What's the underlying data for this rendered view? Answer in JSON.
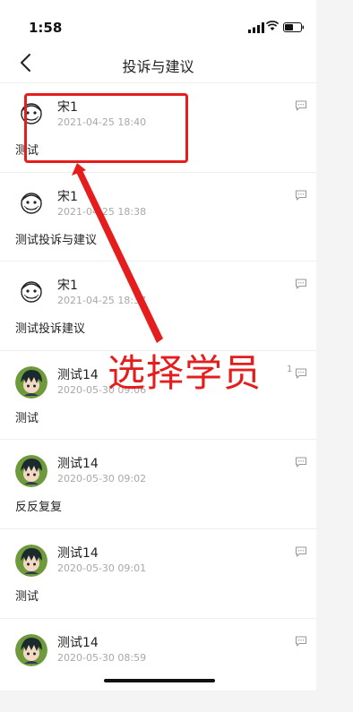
{
  "status_bar": {
    "time": "1:58"
  },
  "header": {
    "title": "投诉与建议"
  },
  "items": [
    {
      "name": "宋1",
      "date": "2021-04-25 18:40",
      "content": "测试",
      "avatar": "face-doodle",
      "comment_count": ""
    },
    {
      "name": "宋1",
      "date": "2021-04-25 18:38",
      "content": "测试投诉与建议",
      "avatar": "face-doodle",
      "comment_count": ""
    },
    {
      "name": "宋1",
      "date": "2021-04-25 18:37",
      "content": "测试投诉建议",
      "avatar": "face-doodle",
      "comment_count": ""
    },
    {
      "name": "测试14",
      "date": "2020-05-30 09:06",
      "content": "测试",
      "avatar": "anime-character",
      "comment_count": "1"
    },
    {
      "name": "测试14",
      "date": "2020-05-30 09:02",
      "content": "反反复复",
      "avatar": "anime-character",
      "comment_count": ""
    },
    {
      "name": "测试14",
      "date": "2020-05-30 09:01",
      "content": "测试",
      "avatar": "anime-character",
      "comment_count": ""
    },
    {
      "name": "测试14",
      "date": "2020-05-30 08:59",
      "content": "",
      "avatar": "anime-character",
      "comment_count": ""
    }
  ],
  "annotation": {
    "text": "选择学员",
    "color": "#e51d1d"
  }
}
